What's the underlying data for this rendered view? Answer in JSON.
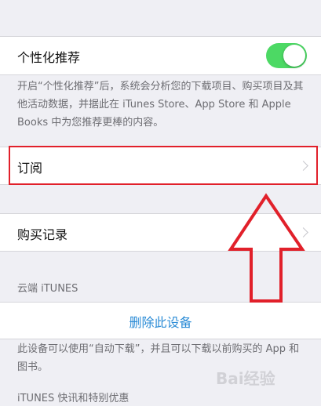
{
  "personalized": {
    "label": "个性化推荐",
    "toggle_on": true,
    "description": "开启“个性化推荐”后，系统会分析您的下载项目、购买项目及其他活动数据，并据此在 iTunes Store、App Store 和 Apple Books 中为您推荐更棒的内容。"
  },
  "subscriptions": {
    "label": "订阅"
  },
  "purchase_history": {
    "label": "购买记录"
  },
  "cloud": {
    "header": "云端 iTUNES",
    "remove_label": "删除此设备",
    "description": "此设备可以使用“自动下载”，并且可以下载以前购买的 App 和图书。"
  },
  "offers": {
    "header": "iTUNES 快讯和特别优惠"
  },
  "colors": {
    "background": "#efeff4",
    "toggle_on": "#4cd964",
    "link_blue": "#2a8bd6",
    "highlight_red": "#e1202a"
  },
  "icons": {
    "chevron": "chevron-right-icon",
    "arrow": "red-up-arrow-annotation-icon"
  },
  "watermark": {
    "text": "Bai经验"
  }
}
